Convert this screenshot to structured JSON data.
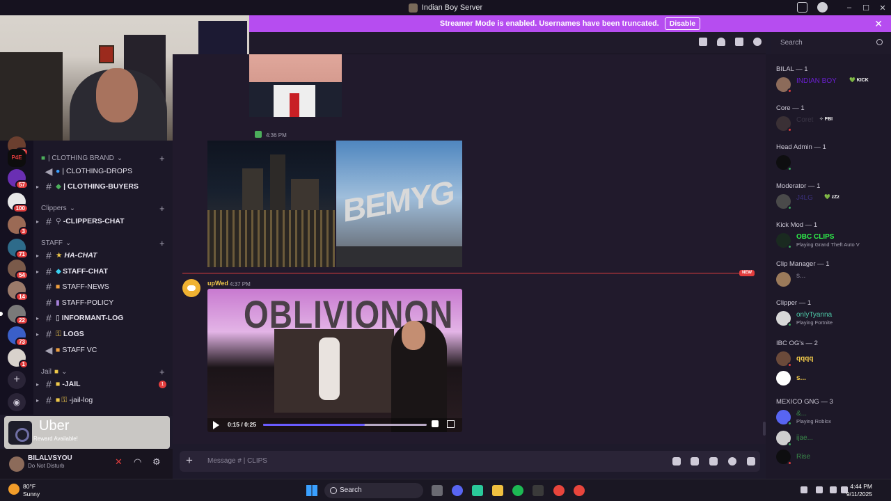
{
  "window": {
    "title": "Indian Boy Server",
    "minimize": "–",
    "maximize": "☐",
    "close": "✕"
  },
  "banner": {
    "text": "Streamer Mode is enabled. Usernames have been truncated.",
    "button": "Disable",
    "close": "✕"
  },
  "servers": [
    {
      "badge": "50",
      "color": "#6b3f2f"
    },
    {
      "badge": "",
      "label": "P4E",
      "color": "#0d0d0d"
    },
    {
      "badge": "57",
      "color": "#6a2fb3"
    },
    {
      "badge": "100",
      "color": "#e8e8e8"
    },
    {
      "badge": "3",
      "color": "#9b6a55"
    },
    {
      "badge": "71",
      "color": "#2e6b8a"
    },
    {
      "badge": "54",
      "color": "#7a5a4a"
    },
    {
      "badge": "14",
      "color": "#9b7a6a"
    },
    {
      "badge": "22",
      "color": "#7a7a7a"
    },
    {
      "badge": "73",
      "color": "#3a5fc8"
    },
    {
      "badge": "1",
      "color": "#d8d2cc"
    }
  ],
  "server_actions": {
    "add": "+",
    "discover": "◉"
  },
  "channels": {
    "cat_clothing": "| CLOTHING BRAND",
    "clothing_drops": "| CLOTHING-DROPS",
    "clothing_buyers": "| CLOTHING-BUYERS",
    "cat_clippers": "Clippers",
    "clippers_chat": "-CLIPPERS-CHAT",
    "cat_staff": "STAFF",
    "ha_chat": "HA-CHAT",
    "staff_chat": "STAFF-CHAT",
    "staff_news": "STAFF-NEWS",
    "staff_policy": "STAFF-POLICY",
    "informant_log": "INFORMANT-LOG",
    "logs": "LOGS",
    "staff_vc": "STAFF VC",
    "cat_jail": "Jail",
    "jail": "-JAIL",
    "jail_unread": "1",
    "jail_log": "-jail-log",
    "plus": "+",
    "chev": "⌄"
  },
  "uber": {
    "name": "Uber",
    "sub": "Reward Available!"
  },
  "user": {
    "name": "BILALVSYOU",
    "status": "Do Not Disturb"
  },
  "chat": {
    "time1": "4:36 PM",
    "img3_text": "BEMYG",
    "new_label": "NEW",
    "author": "upWed",
    "time2": "4:37 PM",
    "video_text": "OBLIVIONON",
    "video_time": "0:15 / 0:25",
    "video_progress": 0.62
  },
  "composer": {
    "add": "+",
    "placeholder": "Message # | CLIPS"
  },
  "search": {
    "placeholder": "Search"
  },
  "members": [
    {
      "cat": "BILAL — 1",
      "items": [
        {
          "name": "INDIAN BOY",
          "color": "#6a1fd1",
          "tag": "💚 KICK",
          "activity": ""
        }
      ]
    },
    {
      "cat": "Core — 1",
      "items": [
        {
          "name": "Coret",
          "color": "#3a3545",
          "tag": "✧ FBI",
          "activity": ""
        }
      ]
    },
    {
      "cat": "Head Admin — 1",
      "items": [
        {
          "name": "",
          "color": "#fff",
          "tag": "",
          "activity": ""
        }
      ]
    },
    {
      "cat": "Moderator — 1",
      "items": [
        {
          "name": "J4LG",
          "color": "#3a2f7a",
          "tag": "💚 zZz",
          "activity": ""
        }
      ]
    },
    {
      "cat": "Kick Mod — 1",
      "items": [
        {
          "name": "OBC CLIPS",
          "color": "#2ef04a",
          "tag": "",
          "activity": "Playing Grand Theft Auto V"
        }
      ]
    },
    {
      "cat": "Clip Manager — 1",
      "items": [
        {
          "name": "s...",
          "color": "#8a8598",
          "tag": "",
          "activity": ""
        }
      ]
    },
    {
      "cat": "Clipper — 1",
      "items": [
        {
          "name": "onlyTyanna",
          "color": "#4ec9a8",
          "tag": "",
          "activity": "Playing Fortnite"
        }
      ]
    },
    {
      "cat": "IBC OG's — 2",
      "items": [
        {
          "name": "qqqq",
          "color": "#f0c94a",
          "tag": "",
          "activity": ""
        },
        {
          "name": "s...",
          "color": "#f0c94a",
          "tag": "",
          "activity": ""
        }
      ]
    },
    {
      "cat": "MEXICO GNG — 3",
      "items": [
        {
          "name": "&...",
          "color": "#3a8a4a",
          "tag": "",
          "activity": "Playing Roblox"
        },
        {
          "name": "ijae...",
          "color": "#3a8a4a",
          "tag": "",
          "activity": ""
        },
        {
          "name": "Rise",
          "color": "#3a8a4a",
          "tag": "",
          "activity": ""
        }
      ]
    }
  ],
  "taskbar": {
    "weather_temp": "80°F",
    "weather_desc": "Sunny",
    "search": "Search",
    "time": "4:44 PM",
    "date": "9/11/2025",
    "discord_badge": "9+"
  }
}
